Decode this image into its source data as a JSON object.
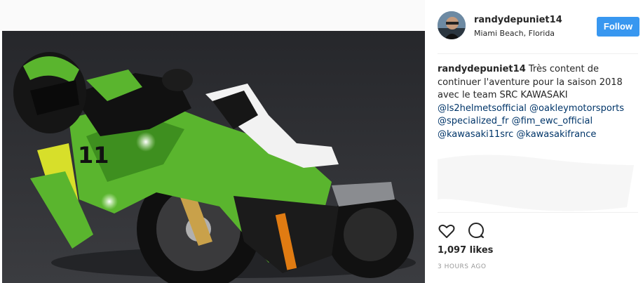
{
  "post": {
    "username": "randydepuniet14",
    "location": "Miami Beach, Florida",
    "follow_label": "Follow",
    "caption": {
      "author": "randydepuniet14",
      "text": " Très content de continuer l'aventure pour la saison 2018 avec le team SRC KAWASAKI",
      "tags": [
        "@ls2helmetsofficial",
        "@oakleymotorsports",
        "@specialized_fr",
        "@fim_ewc_official",
        "@kawasaki11src",
        "@kawasakifrance"
      ]
    },
    "likes": "1,097 likes",
    "timestamp": "3 HOURS AGO"
  },
  "icons": {
    "like": "heart-icon",
    "comment": "comment-icon"
  },
  "colors": {
    "follow_button": "#3897f0",
    "tag_link": "#003569",
    "bike_green": "#5ab52e"
  }
}
